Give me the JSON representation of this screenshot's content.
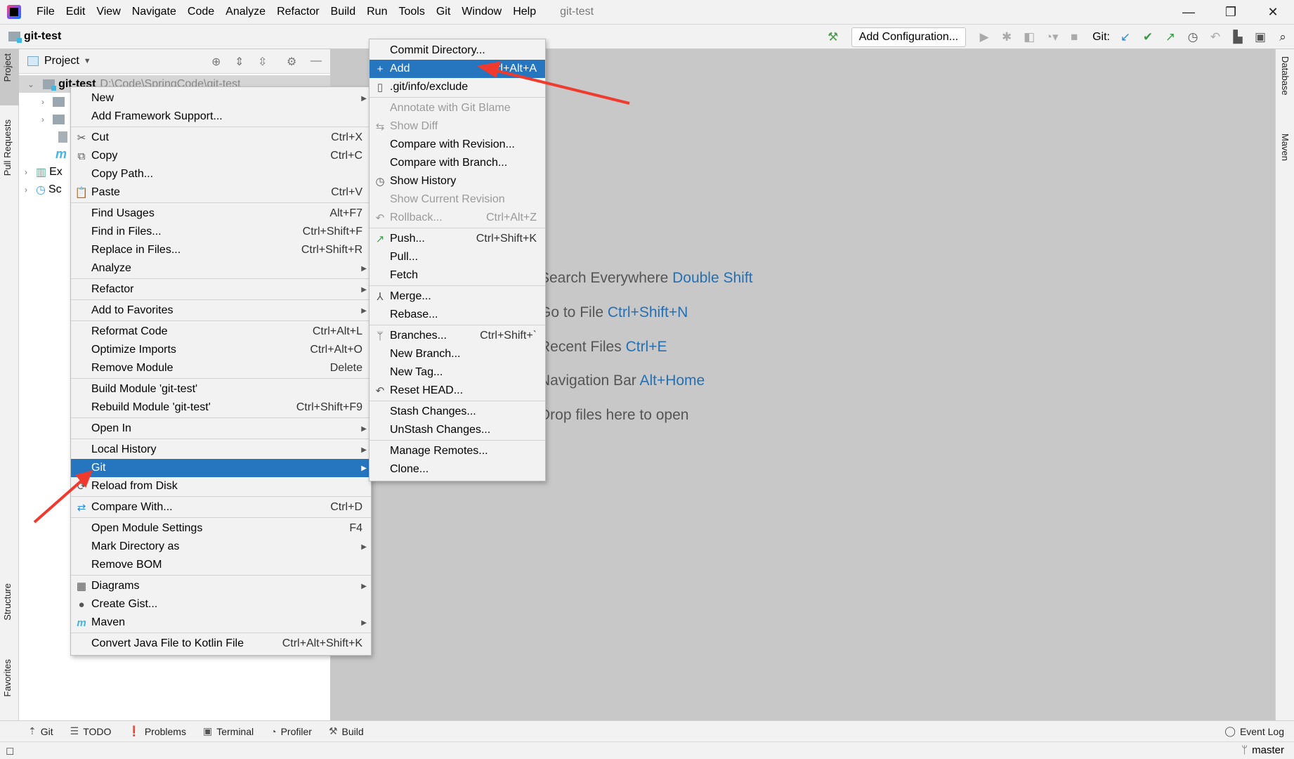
{
  "titlebar": {
    "menus": [
      "File",
      "Edit",
      "View",
      "Navigate",
      "Code",
      "Analyze",
      "Refactor",
      "Build",
      "Run",
      "Tools",
      "Git",
      "Window",
      "Help"
    ],
    "title": "git-test"
  },
  "navbar": {
    "project": "git-test",
    "add_configuration": "Add Configuration...",
    "git_label": "Git:"
  },
  "left_strip": {
    "project": "Project",
    "pull_requests": "Pull Requests",
    "structure": "Structure",
    "favorites": "Favorites"
  },
  "right_strip": {
    "database": "Database",
    "maven": "Maven"
  },
  "project_panel": {
    "title": "Project",
    "root": {
      "name": "git-test",
      "path": "D:\\Code\\SpringCode\\git-test"
    },
    "rows": [
      "",
      "",
      "",
      "",
      "Ex",
      "Sc"
    ]
  },
  "welcome": [
    {
      "text": "Search Everywhere",
      "key": "Double Shift"
    },
    {
      "text": "Go to File",
      "key": "Ctrl+Shift+N"
    },
    {
      "text": "Recent Files",
      "key": "Ctrl+E"
    },
    {
      "text": "Navigation Bar",
      "key": "Alt+Home"
    },
    {
      "text": "Drop files here to open",
      "key": ""
    }
  ],
  "context_menu": [
    {
      "label": "New",
      "sub": true
    },
    {
      "label": "Add Framework Support..."
    },
    {
      "sep": true
    },
    {
      "label": "Cut",
      "shortcut": "Ctrl+X",
      "icon": "✂",
      "iconName": "cut-icon"
    },
    {
      "label": "Copy",
      "shortcut": "Ctrl+C",
      "icon": "⧉",
      "iconName": "copy-icon"
    },
    {
      "label": "Copy Path..."
    },
    {
      "label": "Paste",
      "shortcut": "Ctrl+V",
      "icon": "📋",
      "iconName": "paste-icon"
    },
    {
      "sep": true
    },
    {
      "label": "Find Usages",
      "shortcut": "Alt+F7"
    },
    {
      "label": "Find in Files...",
      "shortcut": "Ctrl+Shift+F"
    },
    {
      "label": "Replace in Files...",
      "shortcut": "Ctrl+Shift+R"
    },
    {
      "label": "Analyze",
      "sub": true
    },
    {
      "sep": true
    },
    {
      "label": "Refactor",
      "sub": true
    },
    {
      "sep": true
    },
    {
      "label": "Add to Favorites",
      "sub": true
    },
    {
      "sep": true
    },
    {
      "label": "Reformat Code",
      "shortcut": "Ctrl+Alt+L"
    },
    {
      "label": "Optimize Imports",
      "shortcut": "Ctrl+Alt+O"
    },
    {
      "label": "Remove Module",
      "shortcut": "Delete"
    },
    {
      "sep": true
    },
    {
      "label": "Build Module 'git-test'"
    },
    {
      "label": "Rebuild Module 'git-test'",
      "shortcut": "Ctrl+Shift+F9"
    },
    {
      "sep": true
    },
    {
      "label": "Open In",
      "sub": true
    },
    {
      "sep": true
    },
    {
      "label": "Local History",
      "sub": true
    },
    {
      "label": "Git",
      "sub": true,
      "selected": true
    },
    {
      "label": "Reload from Disk",
      "icon": "⟳",
      "iconName": "reload-icon"
    },
    {
      "sep": true
    },
    {
      "label": "Compare With...",
      "shortcut": "Ctrl+D",
      "icon": "⇄",
      "iconName": "compare-icon"
    },
    {
      "sep": true
    },
    {
      "label": "Open Module Settings",
      "shortcut": "F4"
    },
    {
      "label": "Mark Directory as",
      "sub": true
    },
    {
      "label": "Remove BOM"
    },
    {
      "sep": true
    },
    {
      "label": "Diagrams",
      "sub": true,
      "icon": "▦",
      "iconName": "diagrams-icon"
    },
    {
      "label": "Create Gist...",
      "icon": "●",
      "iconName": "github-icon"
    },
    {
      "label": "Maven",
      "sub": true,
      "icon": "m",
      "iconName": "maven-icon"
    },
    {
      "sep": true
    },
    {
      "label": "Convert Java File to Kotlin File",
      "shortcut": "Ctrl+Alt+Shift+K"
    }
  ],
  "git_menu": [
    {
      "label": "Commit Directory..."
    },
    {
      "label": "Add",
      "shortcut": "Ctrl+Alt+A",
      "icon": "+",
      "iconName": "plus-icon",
      "selected": true
    },
    {
      "label": ".git/info/exclude",
      "icon": "▯",
      "iconName": "ignore-file-icon"
    },
    {
      "sep": true
    },
    {
      "label": "Annotate with Git Blame",
      "disabled": true
    },
    {
      "label": "Show Diff",
      "disabled": true,
      "icon": "⇆",
      "iconName": "diff-icon"
    },
    {
      "label": "Compare with Revision..."
    },
    {
      "label": "Compare with Branch..."
    },
    {
      "label": "Show History",
      "icon": "◷",
      "iconName": "history-icon"
    },
    {
      "label": "Show Current Revision",
      "disabled": true
    },
    {
      "label": "Rollback...",
      "shortcut": "Ctrl+Alt+Z",
      "disabled": true,
      "icon": "↶",
      "iconName": "rollback-icon"
    },
    {
      "sep": true
    },
    {
      "label": "Push...",
      "shortcut": "Ctrl+Shift+K",
      "icon": "↗",
      "iconName": "push-icon"
    },
    {
      "label": "Pull..."
    },
    {
      "label": "Fetch"
    },
    {
      "sep": true
    },
    {
      "label": "Merge...",
      "icon": "⅄",
      "iconName": "merge-icon"
    },
    {
      "label": "Rebase..."
    },
    {
      "sep": true
    },
    {
      "label": "Branches...",
      "shortcut": "Ctrl+Shift+`",
      "icon": "ᛘ",
      "iconName": "branch-icon"
    },
    {
      "label": "New Branch..."
    },
    {
      "label": "New Tag..."
    },
    {
      "label": "Reset HEAD...",
      "icon": "↶",
      "iconName": "reset-icon"
    },
    {
      "sep": true
    },
    {
      "label": "Stash Changes..."
    },
    {
      "label": "UnStash Changes..."
    },
    {
      "sep": true
    },
    {
      "label": "Manage Remotes..."
    },
    {
      "label": "Clone..."
    }
  ],
  "bottom_tools": [
    {
      "label": "Git",
      "icon": "⇡"
    },
    {
      "label": "TODO",
      "icon": "☰"
    },
    {
      "label": "Problems",
      "icon": "❗"
    },
    {
      "label": "Terminal",
      "icon": "▣"
    },
    {
      "label": "Profiler",
      "icon": "◔"
    },
    {
      "label": "Build",
      "icon": "⚒"
    }
  ],
  "event_log": "Event Log",
  "status": {
    "branch": "master"
  },
  "colors": {
    "selection": "#2675bf",
    "editor_bg": "#c8c8c8",
    "link": "#2470b3",
    "annotation_arrow": "#f03a2e"
  }
}
